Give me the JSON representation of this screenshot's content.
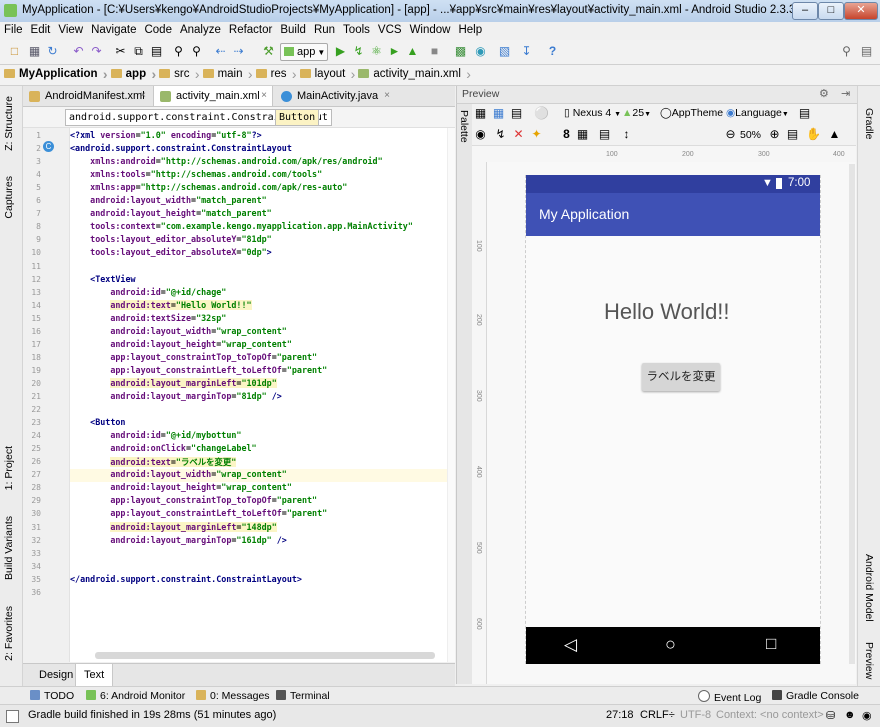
{
  "window": {
    "title": "MyApplication - [C:¥Users¥kengo¥AndroidStudioProjects¥MyApplication] - [app] - ...¥app¥src¥main¥res¥layout¥activity_main.xml - Android Studio 2.3.3",
    "minimize": "–",
    "maximize": "□",
    "close": "✕"
  },
  "menu": [
    "File",
    "Edit",
    "View",
    "Navigate",
    "Code",
    "Analyze",
    "Refactor",
    "Build",
    "Run",
    "Tools",
    "VCS",
    "Window",
    "Help"
  ],
  "toolbar": {
    "run_config": "app"
  },
  "breadcrumbs": [
    "MyApplication",
    "app",
    "src",
    "main",
    "res",
    "layout",
    "activity_main.xml"
  ],
  "editor_tabs": [
    {
      "label": "AndroidManifest.xml",
      "close": "×"
    },
    {
      "label": "activity_main.xml",
      "close": "×"
    },
    {
      "label": "MainActivity.java",
      "close": "×"
    }
  ],
  "xml_breadcrumbs": [
    "android.support.constraint.ConstraintLayout",
    "Button"
  ],
  "code_lines": [
    "<?xml version=\"1.0\" encoding=\"utf-8\"?>",
    "<android.support.constraint.ConstraintLayout",
    "    xmlns:android=\"http://schemas.android.com/apk/res/android\"",
    "    xmlns:tools=\"http://schemas.android.com/tools\"",
    "    xmlns:app=\"http://schemas.android.com/apk/res-auto\"",
    "    android:layout_width=\"match_parent\"",
    "    android:layout_height=\"match_parent\"",
    "    tools:context=\"com.example.kengo.myapplication.app.MainActivity\"",
    "    tools:layout_editor_absoluteY=\"81dp\"",
    "    tools:layout_editor_absoluteX=\"0dp\">",
    "",
    "    <TextView",
    "        android:id=\"@+id/chage\"",
    "        android:text=\"Hello World!!\"",
    "        android:textSize=\"32sp\"",
    "        android:layout_width=\"wrap_content\"",
    "        android:layout_height=\"wrap_content\"",
    "        app:layout_constraintTop_toTopOf=\"parent\"",
    "        app:layout_constraintLeft_toLeftOf=\"parent\"",
    "        android:layout_marginLeft=\"101dp\"",
    "        android:layout_marginTop=\"81dp\" />",
    "",
    "    <Button",
    "        android:id=\"@+id/mybottun\"",
    "        android:onClick=\"changeLabel\"",
    "        android:text=\"ラベルを変更\"",
    "        android:layout_width=\"wrap_content\"",
    "        android:layout_height=\"wrap_content\"",
    "        app:layout_constraintTop_toTopOf=\"parent\"",
    "        app:layout_constraintLeft_toLeftOf=\"parent\"",
    "        android:layout_marginLeft=\"148dp\"",
    "        android:layout_marginTop=\"161dp\" />",
    "",
    "",
    "</android.support.constraint.ConstraintLayout>",
    ""
  ],
  "design_tabs": [
    "Design",
    "Text"
  ],
  "left_tool_tabs": [
    "1: Project",
    "Z: Structure",
    "Captures",
    "Build Variants",
    "2: Favorites"
  ],
  "right_tool_tabs": [
    "Gradle",
    "Android Model",
    "Preview"
  ],
  "preview": {
    "title": "Preview",
    "palette_label": "Palette",
    "device": "Nexus 4",
    "api": "25",
    "theme": "AppTheme",
    "language": "Language",
    "zoom": "50%",
    "ruler_top": [
      "100",
      "200",
      "300",
      "400"
    ],
    "ruler_left": [
      "100",
      "200",
      "300",
      "400",
      "500",
      "600"
    ],
    "time": "7:00",
    "app_title": "My Application",
    "hello_text": "Hello World!!",
    "button_label": "ラベルを変更",
    "nav_back": "◁",
    "nav_home": "○",
    "nav_recent": "□"
  },
  "bottom_tools": [
    {
      "label": "TODO"
    },
    {
      "label": "6: Android Monitor"
    },
    {
      "label": "0: Messages"
    },
    {
      "label": "Terminal"
    },
    {
      "label": "Event Log"
    },
    {
      "label": "Gradle Console"
    }
  ],
  "status": {
    "message": "Gradle build finished in 19s 28ms (51 minutes ago)",
    "position": "27:18",
    "line_sep": "CRLF÷",
    "encoding": "UTF-8",
    "context": "Context: <no context>"
  },
  "colors": {
    "statusbar": "#303f9f",
    "appbar": "#3f51b5",
    "xml_tag": "#000080",
    "xml_attr": "#660e7a",
    "xml_value": "#008000"
  }
}
